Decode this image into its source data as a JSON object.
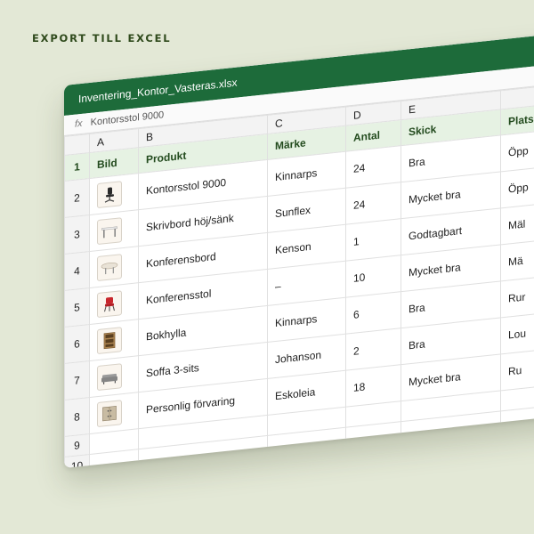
{
  "headline": "EXPORT TILL EXCEL",
  "window": {
    "filename": "Inventering_Kontor_Vasteras.xlsx"
  },
  "formula_bar": {
    "fx": "fx",
    "content": "Kontorsstol 9000"
  },
  "columns": [
    "A",
    "B",
    "C",
    "D",
    "E"
  ],
  "headers": {
    "bild": "Bild",
    "produkt": "Produkt",
    "marke": "Märke",
    "antal": "Antal",
    "skick": "Skick",
    "plats": "Plats"
  },
  "rows": [
    {
      "num": "2",
      "produkt": "Kontorsstol 9000",
      "marke": "Kinnarps",
      "antal": "24",
      "skick": "Bra",
      "plats": "Öpp",
      "icon": "office-chair"
    },
    {
      "num": "3",
      "produkt": "Skrivbord höj/sänk",
      "marke": "Sunflex",
      "antal": "24",
      "skick": "Mycket bra",
      "plats": "Öpp",
      "icon": "desk"
    },
    {
      "num": "4",
      "produkt": "Konferensbord",
      "marke": "Kenson",
      "antal": "1",
      "skick": "Godtagbart",
      "plats": "Mäl",
      "icon": "conference-table"
    },
    {
      "num": "5",
      "produkt": "Konferensstol",
      "marke": "–",
      "antal": "10",
      "skick": "Mycket bra",
      "plats": "Mä",
      "icon": "red-chair"
    },
    {
      "num": "6",
      "produkt": "Bokhylla",
      "marke": "Kinnarps",
      "antal": "6",
      "skick": "Bra",
      "plats": "Rur",
      "icon": "bookshelf"
    },
    {
      "num": "7",
      "produkt": "Soffa 3-sits",
      "marke": "Johanson",
      "antal": "2",
      "skick": "Bra",
      "plats": "Lou",
      "icon": "sofa"
    },
    {
      "num": "8",
      "produkt": "Personlig förvaring",
      "marke": "Eskoleia",
      "antal": "18",
      "skick": "Mycket bra",
      "plats": "Ru",
      "icon": "locker"
    }
  ],
  "header_row_num": "1",
  "empty_rows": [
    "9",
    "10"
  ],
  "colors": {
    "background": "#e3e8d6",
    "titlebar": "#1d6b3a",
    "header_fill": "#e6f2e3",
    "header_text": "#234b1e"
  }
}
